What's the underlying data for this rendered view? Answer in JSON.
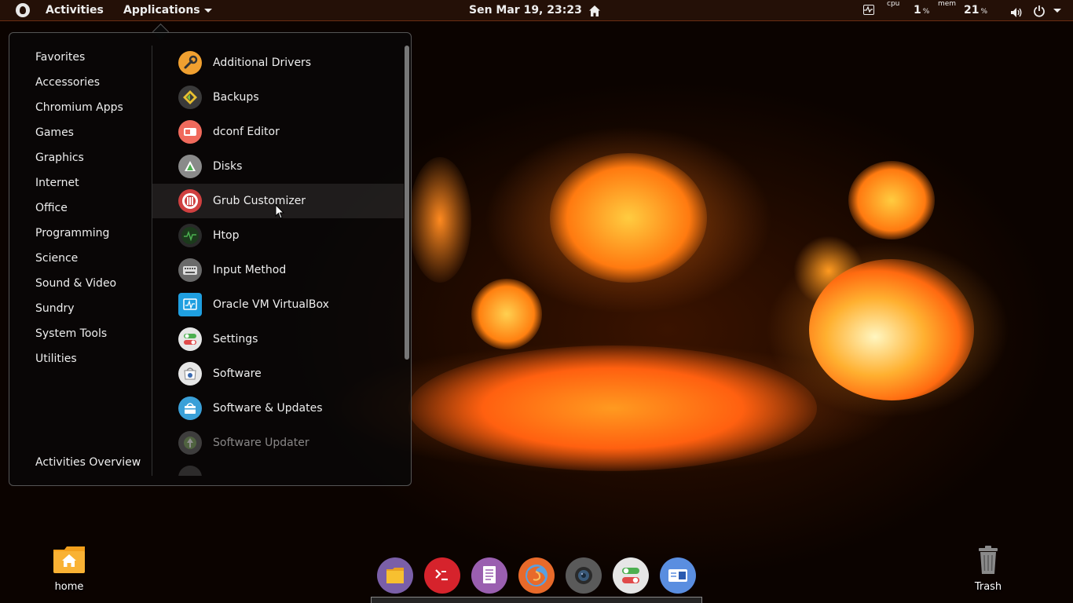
{
  "topbar": {
    "activities_label": "Activities",
    "applications_label": "Applications",
    "clock": "Sen Mar 19, 23:23",
    "cpu_label": "cpu",
    "cpu_value": "1",
    "cpu_unit": "%",
    "mem_label": "mem",
    "mem_value": "21",
    "mem_unit": "%"
  },
  "menu": {
    "categories": [
      {
        "label": "Favorites"
      },
      {
        "label": "Accessories"
      },
      {
        "label": "Chromium Apps"
      },
      {
        "label": "Games"
      },
      {
        "label": "Graphics"
      },
      {
        "label": "Internet"
      },
      {
        "label": "Office"
      },
      {
        "label": "Programming"
      },
      {
        "label": "Science"
      },
      {
        "label": "Sound & Video"
      },
      {
        "label": "Sundry"
      },
      {
        "label": "System Tools"
      },
      {
        "label": "Utilities"
      }
    ],
    "activities_overview": "Activities Overview",
    "apps": [
      {
        "label": "Additional Drivers",
        "icon": "wrench-icon",
        "color": "#f0a030"
      },
      {
        "label": "Backups",
        "icon": "backups-icon",
        "color": "#3a3a3a"
      },
      {
        "label": "dconf Editor",
        "icon": "dconf-icon",
        "color": "#f06a5c"
      },
      {
        "label": "Disks",
        "icon": "disks-icon",
        "color": "#8a8a8a"
      },
      {
        "label": "Grub Customizer",
        "icon": "grub-icon",
        "color": "#d04040"
      },
      {
        "label": "Htop",
        "icon": "htop-icon",
        "color": "#2a2a2a"
      },
      {
        "label": "Input Method",
        "icon": "keyboard-icon",
        "color": "#6a6a6a"
      },
      {
        "label": "Oracle VM VirtualBox",
        "icon": "virtualbox-icon",
        "color": "#1f9fe0"
      },
      {
        "label": "Settings",
        "icon": "settings-icon",
        "color": "#e6e6e6"
      },
      {
        "label": "Software",
        "icon": "software-icon",
        "color": "#e6e6e6"
      },
      {
        "label": "Software & Updates",
        "icon": "software-updates-icon",
        "color": "#3aa0d8"
      },
      {
        "label": "Software Updater",
        "icon": "updater-icon",
        "color": "#6a6a6a"
      }
    ]
  },
  "desktop": {
    "home_label": "home",
    "trash_label": "Trash"
  },
  "dock": {
    "items": [
      {
        "icon": "files-icon",
        "color": "#7a5fa8"
      },
      {
        "icon": "terminal-icon",
        "color": "#d6232c"
      },
      {
        "icon": "text-editor-icon",
        "color": "#9a5fb0"
      },
      {
        "icon": "firefox-icon",
        "color": "#e86a2a"
      },
      {
        "icon": "camera-icon",
        "color": "#5a5a5a"
      },
      {
        "icon": "settings-icon",
        "color": "#e6e6e6"
      },
      {
        "icon": "remote-desktop-icon",
        "color": "#5a8ee0"
      }
    ]
  },
  "colors": {
    "topbar_bg": "#241007",
    "menu_bg": "#080808"
  }
}
